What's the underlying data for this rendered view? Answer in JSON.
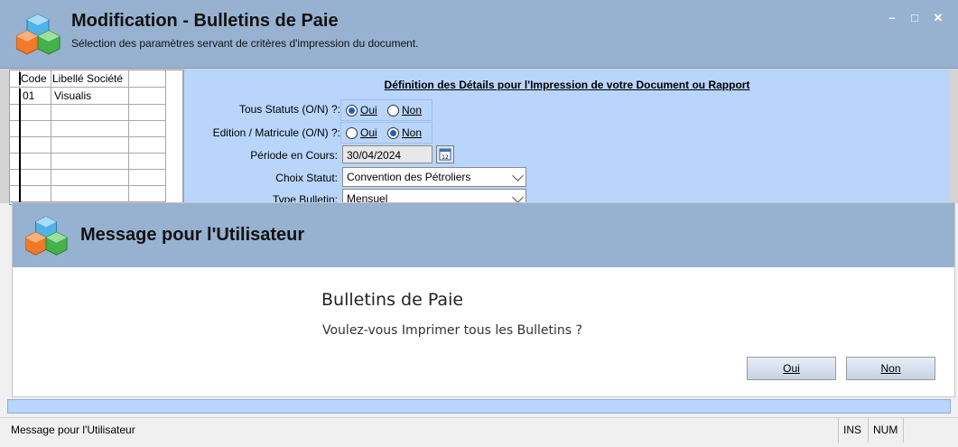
{
  "window": {
    "title": "Modification - Bulletins de Paie",
    "subtitle": "Sélection des paramètres servant de critères d'impression du document.",
    "controls": {
      "minimize": "–",
      "maximize": "□",
      "close": "✕"
    },
    "colors": {
      "header": "#97b1d0",
      "panel": "#b9d5fb"
    }
  },
  "grid": {
    "columns": [
      "Code",
      "Libellé Société"
    ],
    "rows": [
      {
        "code": "01",
        "libelle": "Visualis"
      }
    ]
  },
  "panel": {
    "title": "Définition des Détails pour l'Impression de votre Document ou Rapport",
    "tous_statuts": {
      "label": "Tous Statuts (O/N) ?:",
      "oui": "Oui",
      "non": "Non",
      "selected": "Oui"
    },
    "edition_matricule": {
      "label": "Edition / Matricule (O/N) ?:",
      "oui": "Oui",
      "non": "Non",
      "selected": "Non"
    },
    "periode": {
      "label": "Période en Cours:",
      "value": "30/04/2024",
      "button_icon": "calendar-icon"
    },
    "choix_statut": {
      "label": "Choix Statut:",
      "value": "Convention des Pétroliers"
    },
    "type_bulletin": {
      "label": "Type Bulletin:",
      "value": "Mensuel"
    }
  },
  "dialog": {
    "title": "Message pour l'Utilisateur",
    "message_title": "Bulletins de Paie",
    "message_text": "Voulez-vous Imprimer tous les Bulletins ?",
    "buttons": {
      "yes": "Oui",
      "no": "Non"
    }
  },
  "status_bar": {
    "message": "Message pour l'Utilisateur",
    "ins": "INS",
    "num": "NUM"
  }
}
